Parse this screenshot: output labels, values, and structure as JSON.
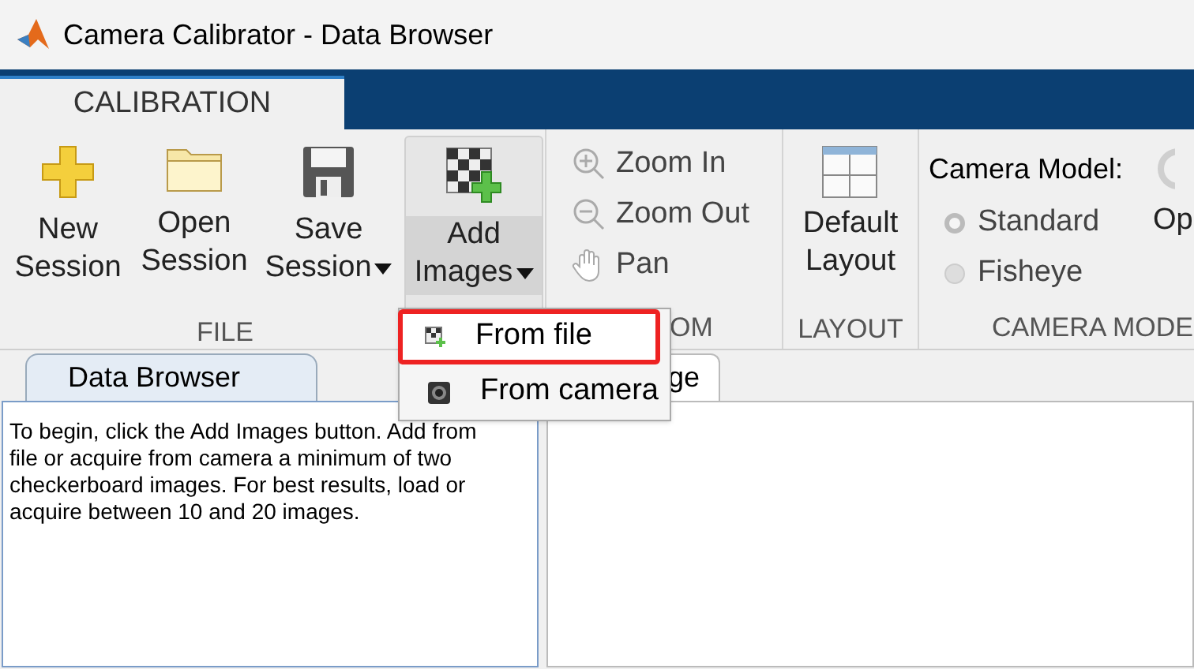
{
  "window": {
    "title": "Camera Calibrator - Data Browser"
  },
  "tabs": [
    {
      "label": "CALIBRATION",
      "selected": true
    }
  ],
  "file_section": {
    "label": "FILE",
    "buttons": [
      {
        "kind": "new",
        "label_1": "New",
        "label_2": "Session",
        "dropdown": false,
        "pressed": false
      },
      {
        "kind": "open",
        "label_1": "Open",
        "label_2": "Session",
        "dropdown": false,
        "pressed": false
      },
      {
        "kind": "save",
        "label_1": "Save",
        "label_2": "Session",
        "dropdown": true,
        "pressed": false
      },
      {
        "kind": "add",
        "label_1": "Add",
        "label_2": "Images",
        "dropdown": true,
        "pressed": true
      }
    ]
  },
  "zoom_section": {
    "label": "OM",
    "items": [
      {
        "kind": "zoom_in",
        "label": "Zoom In",
        "disabled": true
      },
      {
        "kind": "zoom_out",
        "label": "Zoom Out",
        "disabled": true
      },
      {
        "kind": "pan",
        "label": "Pan",
        "disabled": true
      }
    ]
  },
  "layout_section": {
    "label": "LAYOUT",
    "button": {
      "label_1": "Default",
      "label_2": "Layout"
    }
  },
  "camera_section": {
    "label": "CAMERA MODE",
    "heading": "Camera Model:",
    "options": [
      {
        "label": "Standard",
        "selected": true,
        "disabled": true
      },
      {
        "label": "Fisheye",
        "selected": false,
        "disabled": true
      }
    ],
    "options_button": "Op"
  },
  "menu": {
    "items": [
      {
        "kind": "file",
        "label": "From file",
        "highlighted": true
      },
      {
        "kind": "camera",
        "label": "From camera",
        "highlighted": false
      }
    ]
  },
  "left_panel": {
    "tab": "Data Browser",
    "message": "To begin, click the Add Images button. Add from file or acquire from camera a minimum of two checkerboard images. For best results, load or acquire between 10 and 20 images."
  },
  "right_panel": {
    "tab": "ge"
  }
}
